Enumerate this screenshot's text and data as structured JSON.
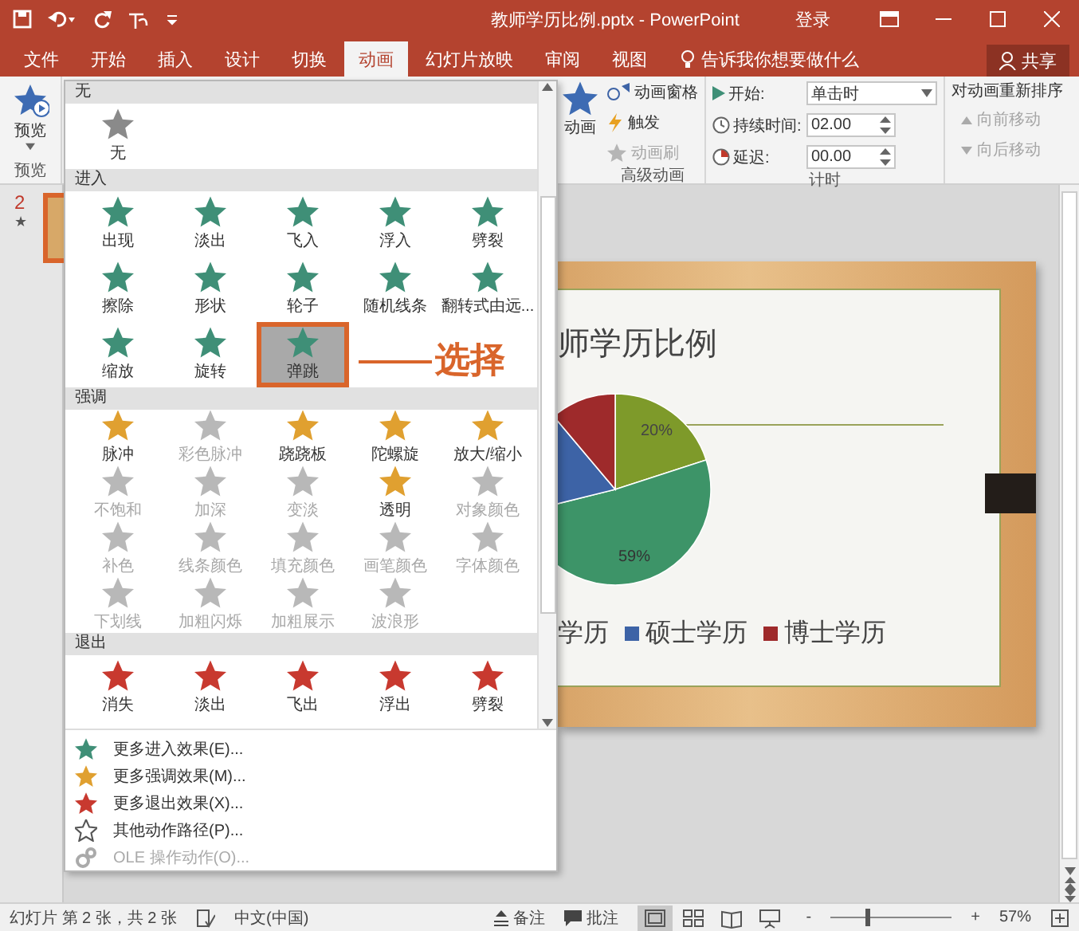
{
  "window": {
    "title": "教师学历比例.pptx  -  PowerPoint",
    "sign_in": "登录"
  },
  "tabs": [
    {
      "label": "文件",
      "selected": false
    },
    {
      "label": "开始",
      "selected": false
    },
    {
      "label": "插入",
      "selected": false
    },
    {
      "label": "设计",
      "selected": false
    },
    {
      "label": "切换",
      "selected": false
    },
    {
      "label": "动画",
      "selected": true
    },
    {
      "label": "幻灯片放映",
      "selected": false
    },
    {
      "label": "审阅",
      "selected": false
    },
    {
      "label": "视图",
      "selected": false
    }
  ],
  "tell_me": "告诉我你想要做什么",
  "share": "共享",
  "ribbon": {
    "preview": {
      "label": "预览",
      "group": "预览"
    },
    "add_animation": "动画",
    "advanced": {
      "group": "高级动画",
      "items": [
        {
          "kind": "pane",
          "label": "动画窗格",
          "disabled": false
        },
        {
          "kind": "trigger",
          "label": "触发",
          "disabled": false
        },
        {
          "kind": "painter",
          "label": "动画刷",
          "disabled": true
        }
      ]
    },
    "timing": {
      "group": "计时",
      "start_label": "开始:",
      "start_value": "单击时",
      "duration_label": "持续时间:",
      "duration_value": "02.00",
      "delay_label": "延迟:",
      "delay_value": "00.00"
    },
    "reorder": {
      "title": "对动画重新排序",
      "items": [
        {
          "kind": "earlier",
          "label": "向前移动",
          "disabled": true
        },
        {
          "kind": "later",
          "label": "向后移动",
          "disabled": true
        }
      ]
    }
  },
  "slides_pane": {
    "number": "2",
    "marker": "★",
    "selected": true
  },
  "gallery": {
    "sections": [
      {
        "kind": "none",
        "title": "无",
        "items": [
          {
            "label": "无",
            "selected": false,
            "disabled": false
          }
        ]
      },
      {
        "kind": "entrance",
        "title": "进入",
        "items": [
          {
            "label": "出现",
            "selected": false,
            "disabled": false
          },
          {
            "label": "淡出",
            "selected": false,
            "disabled": false
          },
          {
            "label": "飞入",
            "selected": false,
            "disabled": false
          },
          {
            "label": "浮入",
            "selected": false,
            "disabled": false
          },
          {
            "label": "劈裂",
            "selected": false,
            "disabled": false
          },
          {
            "label": "擦除",
            "selected": false,
            "disabled": false
          },
          {
            "label": "形状",
            "selected": false,
            "disabled": false
          },
          {
            "label": "轮子",
            "selected": false,
            "disabled": false
          },
          {
            "label": "随机线条",
            "selected": false,
            "disabled": false
          },
          {
            "label": "翻转式由远...",
            "selected": false,
            "disabled": false
          },
          {
            "label": "缩放",
            "selected": false,
            "disabled": false
          },
          {
            "label": "旋转",
            "selected": false,
            "disabled": false
          },
          {
            "label": "弹跳",
            "selected": true,
            "disabled": false
          }
        ]
      },
      {
        "kind": "emphasis",
        "title": "强调",
        "items": [
          {
            "label": "脉冲",
            "selected": false,
            "disabled": false
          },
          {
            "label": "彩色脉冲",
            "selected": false,
            "disabled": true
          },
          {
            "label": "跷跷板",
            "selected": false,
            "disabled": false
          },
          {
            "label": "陀螺旋",
            "selected": false,
            "disabled": false
          },
          {
            "label": "放大/缩小",
            "selected": false,
            "disabled": false
          },
          {
            "label": "不饱和",
            "selected": false,
            "disabled": true
          },
          {
            "label": "加深",
            "selected": false,
            "disabled": true
          },
          {
            "label": "变淡",
            "selected": false,
            "disabled": true
          },
          {
            "label": "透明",
            "selected": false,
            "disabled": false
          },
          {
            "label": "对象颜色",
            "selected": false,
            "disabled": true
          },
          {
            "label": "补色",
            "selected": false,
            "disabled": true
          },
          {
            "label": "线条颜色",
            "selected": false,
            "disabled": true
          },
          {
            "label": "填充颜色",
            "selected": false,
            "disabled": true
          },
          {
            "label": "画笔颜色",
            "selected": false,
            "disabled": true
          },
          {
            "label": "字体颜色",
            "selected": false,
            "disabled": true
          },
          {
            "label": "下划线",
            "selected": false,
            "disabled": true
          },
          {
            "label": "加粗闪烁",
            "selected": false,
            "disabled": true
          },
          {
            "label": "加粗展示",
            "selected": false,
            "disabled": true
          },
          {
            "label": "波浪形",
            "selected": false,
            "disabled": true
          }
        ]
      },
      {
        "kind": "exit",
        "title": "退出",
        "items": [
          {
            "label": "消失",
            "selected": false,
            "disabled": false
          },
          {
            "label": "淡出",
            "selected": false,
            "disabled": false
          },
          {
            "label": "飞出",
            "selected": false,
            "disabled": false
          },
          {
            "label": "浮出",
            "selected": false,
            "disabled": false
          },
          {
            "label": "劈裂",
            "selected": false,
            "disabled": false
          }
        ]
      }
    ],
    "menu": [
      {
        "kind": "entrance",
        "label": "更多进入效果(E)...",
        "disabled": false
      },
      {
        "kind": "emphasis",
        "label": "更多强调效果(M)...",
        "disabled": false
      },
      {
        "kind": "exit",
        "label": "更多退出效果(X)...",
        "disabled": false
      },
      {
        "kind": "path",
        "label": "其他动作路径(P)...",
        "disabled": false
      },
      {
        "kind": "ole",
        "label": "OLE 操作动作(O)...",
        "disabled": true
      }
    ]
  },
  "callout": "选择",
  "slide": {
    "title": "师学历比例",
    "pie_labels": [
      "20%",
      "59%"
    ],
    "legend": [
      {
        "label": "学历"
      },
      {
        "label": "硕士学历",
        "color": "#3d63a6"
      },
      {
        "label": "博士学历",
        "color": "#9e2a2b"
      }
    ]
  },
  "status": {
    "slide_info": "幻灯片 第 2 张，共 2 张",
    "language": "中文(中国)",
    "notes": "备注",
    "comments": "批注",
    "views": [
      {
        "kind": "normal",
        "selected": true
      },
      {
        "kind": "sorter",
        "selected": false
      },
      {
        "kind": "reading",
        "selected": false
      },
      {
        "kind": "slideshow",
        "selected": false
      }
    ],
    "zoom_minus": "-",
    "zoom_plus": "+",
    "zoom": "57%",
    "level": 0.3
  }
}
